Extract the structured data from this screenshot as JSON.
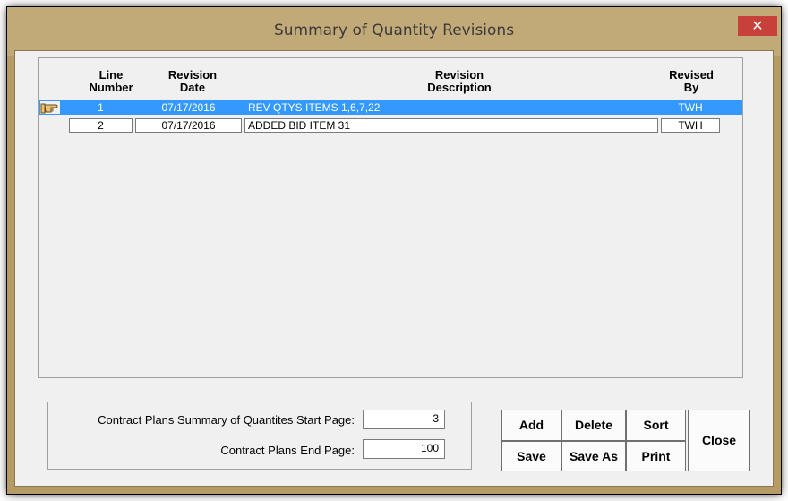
{
  "window": {
    "title": "Summary of Quantity Revisions",
    "close_glyph": "✕"
  },
  "columns": {
    "line": [
      "Line",
      "Number"
    ],
    "date": [
      "Revision",
      "Date"
    ],
    "desc": [
      "Revision",
      "Description"
    ],
    "by": [
      "Revised",
      "By"
    ]
  },
  "rows": [
    {
      "line": "1",
      "date": "07/17/2016",
      "desc": "REV QTYS ITEMS 1,6,7,22",
      "by": "TWH",
      "selected": true
    },
    {
      "line": "2",
      "date": "07/17/2016",
      "desc": "ADDED BID ITEM 31",
      "by": "TWH",
      "selected": false
    }
  ],
  "form": {
    "start_label": "Contract Plans Summary of Quantites Start Page:",
    "start_value": "3",
    "end_label": "Contract Plans End Page:",
    "end_value": "100"
  },
  "buttons": {
    "add": "Add",
    "delete": "Delete",
    "sort": "Sort",
    "save": "Save",
    "save_as": "Save As",
    "print": "Print",
    "close": "Close"
  },
  "colors": {
    "title_bar": "#c2aa78",
    "selection": "#3399ff",
    "close": "#c7403a"
  },
  "icons": {
    "row_pointer": "pointing-hand-icon",
    "close": "close-icon"
  }
}
